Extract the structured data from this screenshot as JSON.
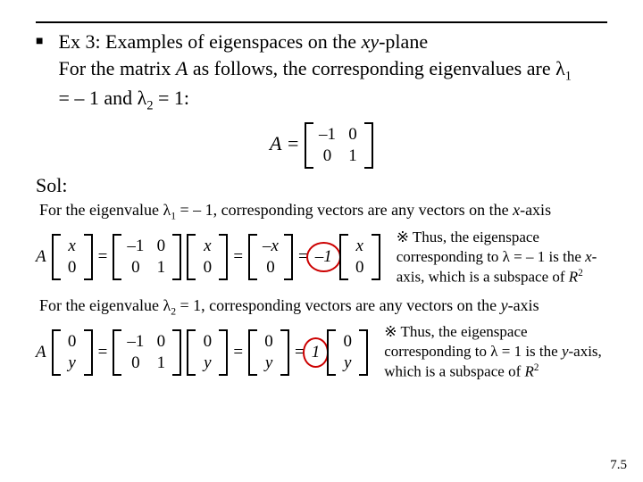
{
  "heading": {
    "title_line1": "Ex 3: Examples of eigenspaces on the ",
    "title_line1_ital": "xy",
    "title_line1_rest": "-plane",
    "line2a": "For the matrix ",
    "line2_A": "A",
    "line2b": " as follows, the corresponding eigenvalues are ",
    "lam": "λ",
    "sub1": "1",
    "eqtext1": " = – 1 and ",
    "sub2": "2",
    "eqtext2": " = 1:"
  },
  "matA": {
    "label": "A =",
    "r1c1": "–1",
    "r1c2": "0",
    "r2c1": "0",
    "r2c2": "1"
  },
  "sol_label": "Sol:",
  "case1": {
    "line": "For the eigenvalue λ",
    "sub": "1",
    "rest": " = – 1, corresponding vectors are any vectors on the ",
    "axis": "x",
    "tail": "-axis",
    "vec_in_r1": "x",
    "vec_in_r2": "0",
    "A_r1c1": "–1",
    "A_r1c2": "0",
    "A_r2c1": "0",
    "A_r2c2": "1",
    "mid_r1": "–x",
    "mid_r2": "0",
    "scalar": "–1",
    "note_pre": "※ Thus, the eigenspace corresponding to λ = – 1 is the ",
    "note_axis": "x",
    "note_post": "-axis, which is a subspace of ",
    "space": "R",
    "sup": "2"
  },
  "case2": {
    "line": "For the eigenvalue λ",
    "sub": "2",
    "rest": " = 1, corresponding vectors are any vectors on the ",
    "axis": "y",
    "tail": "-axis",
    "vec_in_r1": "0",
    "vec_in_r2": "y",
    "A_r1c1": "–1",
    "A_r1c2": "0",
    "A_r2c1": "0",
    "A_r2c2": "1",
    "mid_r1": "0",
    "mid_r2": "y",
    "scalar": "1",
    "note_pre": "※ Thus, the eigenspace corresponding to λ = 1 is the ",
    "note_axis": "y",
    "note_post": "-axis, which is a subspace of ",
    "space": "R",
    "sup": "2"
  },
  "slidenum": "7.5"
}
